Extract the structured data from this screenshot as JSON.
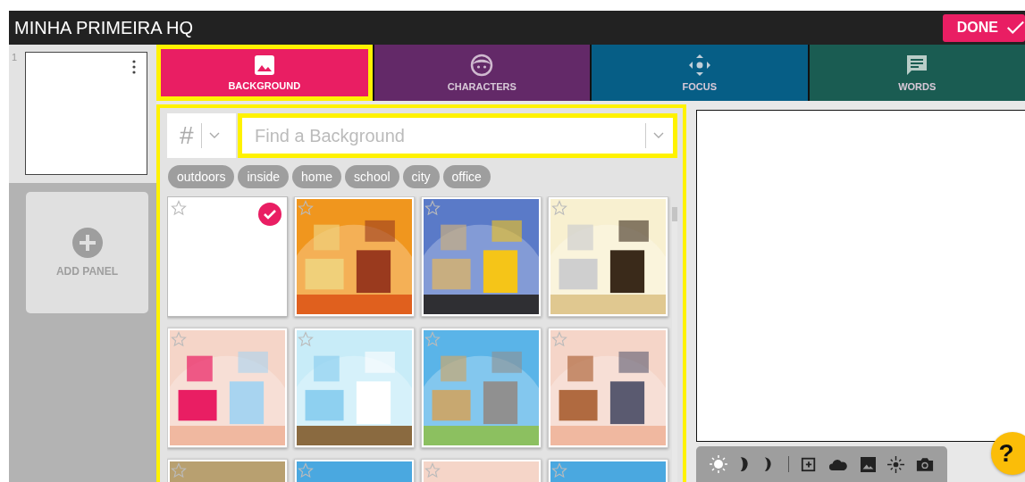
{
  "header": {
    "title": "MINHA PRIMEIRA HQ",
    "done_button": "DONE"
  },
  "panels": [
    {
      "number": "1"
    }
  ],
  "add_panel": "ADD PANEL",
  "tabs": [
    {
      "label": "BACKGROUND",
      "selected": true,
      "highlighted": true,
      "color": "#e91e63"
    },
    {
      "label": "CHARACTERS",
      "selected": false,
      "highlighted": false,
      "color": "#6a2c70"
    },
    {
      "label": "FOCUS",
      "selected": false,
      "highlighted": false,
      "color": "#066590"
    },
    {
      "label": "WORDS",
      "selected": false,
      "highlighted": false,
      "color": "#1b6358"
    }
  ],
  "library": {
    "highlighted": true,
    "search": {
      "filter_symbol": "#",
      "placeholder": "Find a Background",
      "highlighted": true
    },
    "tags": [
      "outdoors",
      "inside",
      "home",
      "school",
      "city",
      "office"
    ],
    "backgrounds": [
      {
        "kind": "blank",
        "selected": true
      },
      {
        "kind": "picture",
        "selected": false
      },
      {
        "kind": "picture",
        "selected": false
      },
      {
        "kind": "picture",
        "selected": false
      },
      {
        "kind": "picture",
        "selected": false
      },
      {
        "kind": "picture",
        "selected": false
      },
      {
        "kind": "picture",
        "selected": false
      },
      {
        "kind": "picture",
        "selected": false
      },
      {
        "kind": "picture",
        "selected": false
      },
      {
        "kind": "picture",
        "selected": false
      },
      {
        "kind": "picture",
        "selected": false
      },
      {
        "kind": "picture",
        "selected": false
      }
    ]
  },
  "help_button": "?"
}
